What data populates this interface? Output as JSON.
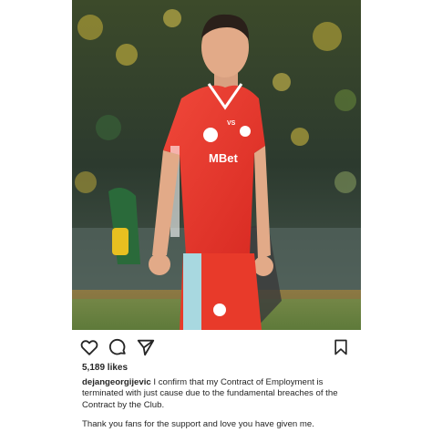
{
  "post": {
    "likes": "5,189 likes",
    "username": "dejangeorgijevic",
    "caption_line1": " I confirm that my Contract of Employment is terminated with just cause due to the fundamental breaches of the Contract by the Club.",
    "caption_line2": "Thank you fans for the support and love you have given me."
  },
  "photo": {
    "jersey_sponsor": "MBet",
    "kit_brand": "VS"
  },
  "icons": {
    "like": "heart-icon",
    "comment": "comment-icon",
    "share": "send-icon",
    "save": "bookmark-icon"
  },
  "colors": {
    "jersey_red": "#e8342a",
    "text": "#262626",
    "background": "#ffffff"
  }
}
